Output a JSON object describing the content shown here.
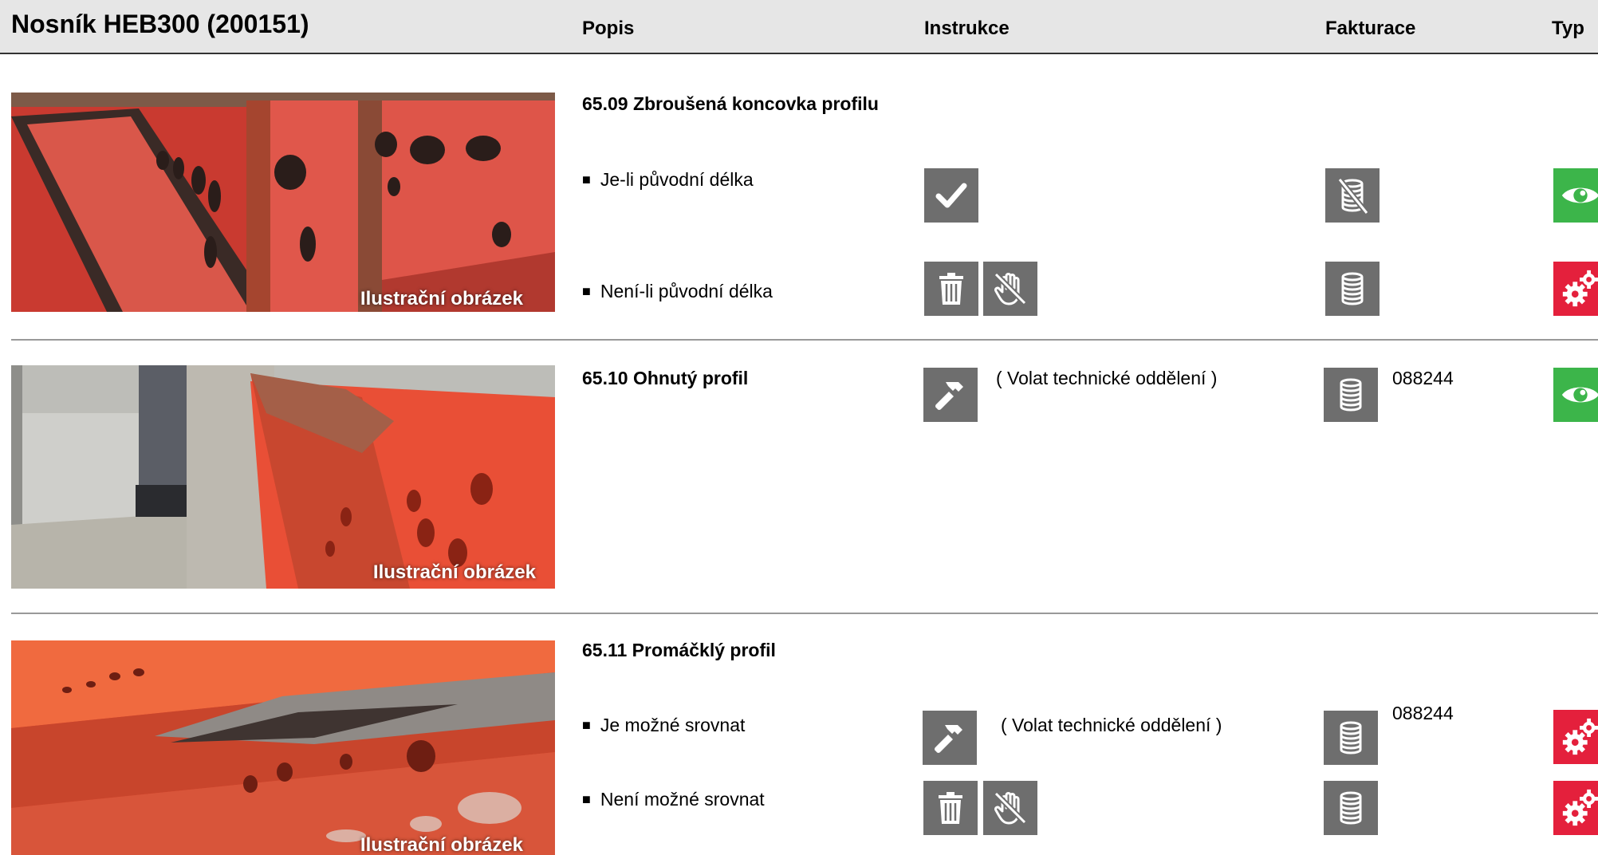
{
  "header": {
    "title": "Nosník HEB300 (200151)",
    "col_popis": "Popis",
    "col_instrukce": "Instrukce",
    "col_fakturace": "Fakturace",
    "col_typ": "Typ"
  },
  "photo_caption": "Ilustrační obrázek",
  "sections": [
    {
      "title": "65.09 Zbroušená koncovka profilu",
      "rows": [
        {
          "label": "Je-li původní délka",
          "instr_icons": [
            "check-icon"
          ],
          "billing_icon": "no-billing-coins-icon",
          "type_icon": "eye-icon",
          "type_color": "#3cb54a"
        },
        {
          "label": "Není-li původní délka",
          "instr_icons": [
            "trash-icon",
            "no-hand-icon"
          ],
          "billing_icon": "coins-icon",
          "type_icon": "gears-icon",
          "type_color": "#e4203c"
        }
      ]
    },
    {
      "title": "65.10 Ohnutý profil",
      "rows": [
        {
          "label": "",
          "instr_icons": [
            "hammer-icon"
          ],
          "note": "( Volat technické oddělení )",
          "billing_icon": "coins-icon",
          "code": "088244",
          "type_icon": "eye-icon",
          "type_color": "#3cb54a"
        }
      ]
    },
    {
      "title": "65.11 Promáčklý profil",
      "rows": [
        {
          "label": "Je možné srovnat",
          "instr_icons": [
            "hammer-icon"
          ],
          "note": "( Volat technické oddělení )",
          "billing_icon": "coins-icon",
          "code": "088244",
          "type_icon": "gears-icon",
          "type_color": "#e4203c"
        },
        {
          "label": "Není možné srovnat",
          "instr_icons": [
            "trash-icon",
            "no-hand-icon"
          ],
          "billing_icon": "coins-icon",
          "type_icon": "gears-icon",
          "type_color": "#e4203c"
        }
      ]
    }
  ]
}
